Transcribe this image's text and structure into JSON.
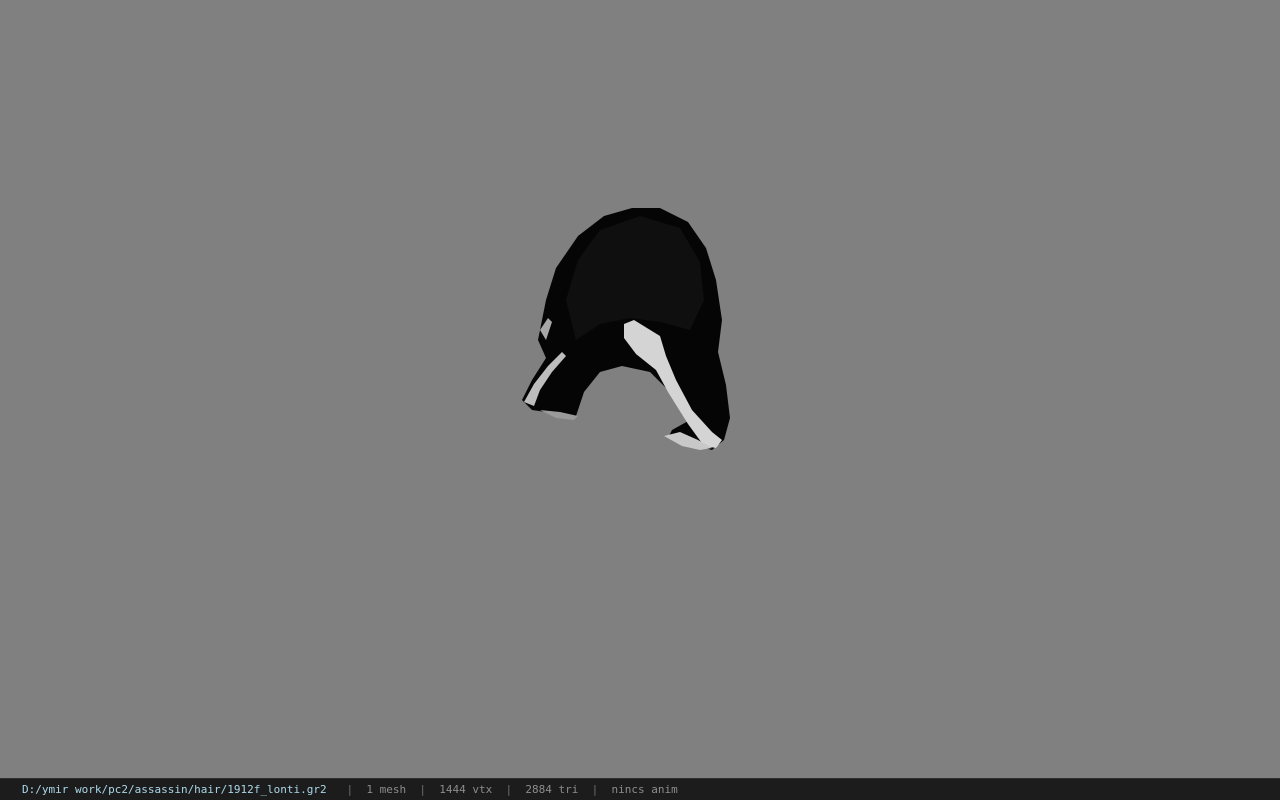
{
  "viewer": {
    "background_color": "#808080",
    "model_color": "#050505",
    "highlight_color": "#d4d4d4"
  },
  "status_bar": {
    "file_path": "D:/ymir work/pc2/assassin/hair/1912f_lonti.gr2",
    "separator": "|",
    "mesh_count": "1 mesh",
    "vertex_count": "1444 vtx",
    "triangle_count": "2884 tri",
    "animation_status": "nincs anim"
  }
}
